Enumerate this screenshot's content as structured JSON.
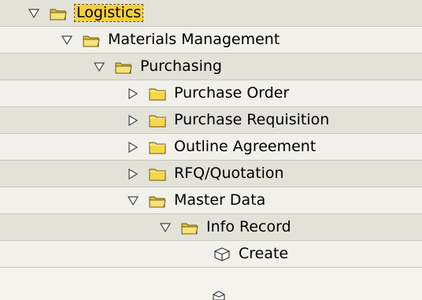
{
  "tree": {
    "nodes": [
      {
        "label": "Logistics",
        "toggle": "expanded",
        "icon": "folder-open-icon",
        "selected": true
      },
      {
        "label": "Materials Management",
        "toggle": "expanded",
        "icon": "folder-open-icon"
      },
      {
        "label": "Purchasing",
        "toggle": "expanded",
        "icon": "folder-open-icon"
      },
      {
        "label": "Purchase Order",
        "toggle": "collapsed",
        "icon": "folder-closed-icon"
      },
      {
        "label": "Purchase Requisition",
        "toggle": "collapsed",
        "icon": "folder-closed-icon"
      },
      {
        "label": "Outline Agreement",
        "toggle": "collapsed",
        "icon": "folder-closed-icon"
      },
      {
        "label": "RFQ/Quotation",
        "toggle": "collapsed",
        "icon": "folder-closed-icon"
      },
      {
        "label": "Master Data",
        "toggle": "expanded",
        "icon": "folder-open-icon"
      },
      {
        "label": "Info Record",
        "toggle": "expanded",
        "icon": "folder-open-icon"
      },
      {
        "label": "Create",
        "toggle": "none",
        "icon": "transaction-cube-icon"
      }
    ]
  },
  "colors": {
    "selection": "#f8d03c",
    "row_shade": "#e3e2d9",
    "row_light": "#f1f0ea",
    "folder_fill": "#f4d84c"
  }
}
